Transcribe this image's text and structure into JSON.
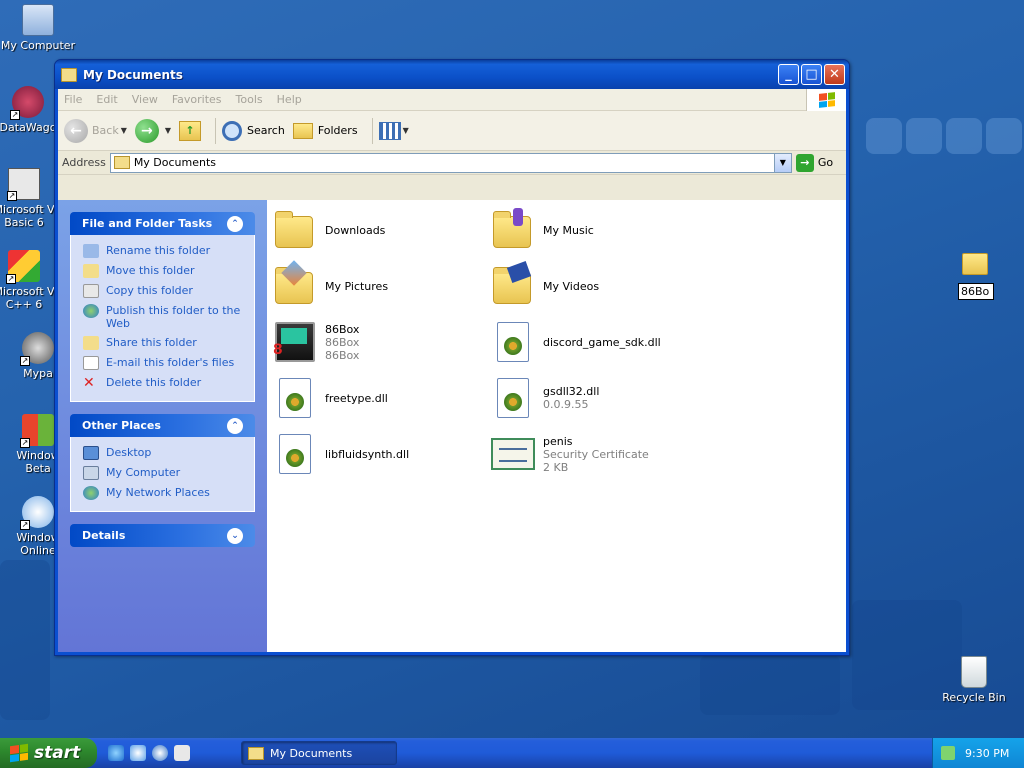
{
  "desktop": {
    "icons": [
      {
        "label": "My Computer"
      },
      {
        "label": "DataWago"
      },
      {
        "label": "Microsoft V",
        "label2": "Basic 6"
      },
      {
        "label": "Microsoft V",
        "label2": "C++ 6"
      },
      {
        "label": "Mypa"
      },
      {
        "label": "Window",
        "label2": "Beta"
      },
      {
        "label": "Window",
        "label2": "Online"
      },
      {
        "label": "Recycle Bin"
      }
    ],
    "rename_value": "86Bo"
  },
  "window": {
    "title": "My Documents",
    "menu": [
      "File",
      "Edit",
      "View",
      "Favorites",
      "Tools",
      "Help"
    ],
    "toolbar": {
      "back": "Back",
      "search": "Search",
      "folders": "Folders"
    },
    "address": {
      "label": "Address",
      "value": "My Documents",
      "go": "Go"
    },
    "taskpane": {
      "file_tasks": {
        "title": "File and Folder Tasks",
        "items": [
          "Rename this folder",
          "Move this folder",
          "Copy this folder",
          "Publish this folder to the Web",
          "Share this folder",
          "E-mail this folder's files",
          "Delete this folder"
        ]
      },
      "other_places": {
        "title": "Other Places",
        "items": [
          "Desktop",
          "My Computer",
          "My Network Places"
        ]
      },
      "details": {
        "title": "Details"
      }
    },
    "files": [
      {
        "name": "Downloads",
        "type": "folder"
      },
      {
        "name": "My Music",
        "type": "folder"
      },
      {
        "name": "My Pictures",
        "type": "folder"
      },
      {
        "name": "My Videos",
        "type": "folder"
      },
      {
        "name": "86Box",
        "line2": "86Box",
        "line3": "86Box",
        "type": "exe"
      },
      {
        "name": "discord_game_sdk.dll",
        "type": "dll"
      },
      {
        "name": "freetype.dll",
        "type": "dll"
      },
      {
        "name": "gsdll32.dll",
        "line2": "0.0.9.55",
        "type": "dll"
      },
      {
        "name": "libfluidsynth.dll",
        "type": "dll"
      },
      {
        "name": "penis",
        "line2": "Security Certificate",
        "line3": "2 KB",
        "type": "certificate"
      }
    ]
  },
  "taskbar": {
    "start": "start",
    "task_button": "My Documents",
    "clock": "9:30 PM"
  },
  "colors": {
    "titlebar": "#0b50c8",
    "taskpane_link": "#215dc6",
    "start_green": "#2e8a2e"
  }
}
